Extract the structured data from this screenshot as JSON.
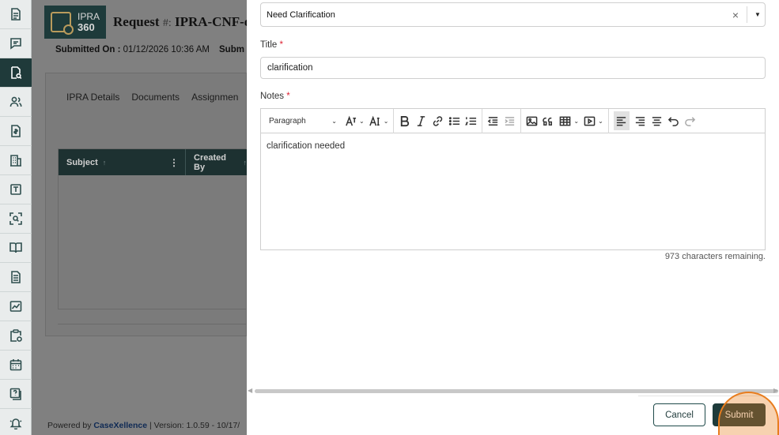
{
  "sidebar": {
    "items": [
      {
        "icon": "document-icon",
        "active": false
      },
      {
        "icon": "message-icon",
        "active": false
      },
      {
        "icon": "search-document-icon",
        "active": true
      },
      {
        "icon": "users-icon",
        "active": false
      },
      {
        "icon": "invoice-icon",
        "active": false
      },
      {
        "icon": "building-icon",
        "active": false
      },
      {
        "icon": "template-icon",
        "active": false
      },
      {
        "icon": "scan-icon",
        "active": false
      },
      {
        "icon": "book-icon",
        "active": false
      },
      {
        "icon": "file-text-icon",
        "active": false
      },
      {
        "icon": "chart-icon",
        "active": false
      },
      {
        "icon": "clipboard-icon",
        "active": false
      },
      {
        "icon": "calendar-icon",
        "active": false
      },
      {
        "icon": "help-icon",
        "active": false
      },
      {
        "icon": "bell-icon",
        "active": false
      }
    ]
  },
  "background": {
    "brand_line1": "IPRA",
    "brand_line2": "360",
    "request_prefix": "Request ",
    "request_hash": "#:",
    "request_number": " IPRA-CNF-oc",
    "submitted_label": "Submitted On :",
    "submitted_value": " 01/12/2026 10:36 AM",
    "submitted_next": "Subm",
    "tabs": [
      "IPRA Details",
      "Documents",
      "Assignmen"
    ],
    "grid_columns": [
      "Subject",
      "Created By"
    ],
    "footer_powered": "Powered by ",
    "footer_brand": "CaseXellence",
    "footer_version": " |  Version: 1.0.59 - 10/17/"
  },
  "form": {
    "status_value": "Need Clarification",
    "title_label": "Title",
    "title_value": "clarification",
    "notes_label": "Notes",
    "required_mark": "*",
    "paragraph_label": "Paragraph",
    "notes_value": "clarification needed",
    "chars_remaining": "973 characters remaining.",
    "cancel_label": "Cancel",
    "submit_label": "Submit"
  },
  "colors": {
    "brand_dark": "#1e3b3b",
    "highlight": "#e87d1e",
    "required": "#dd2233"
  }
}
